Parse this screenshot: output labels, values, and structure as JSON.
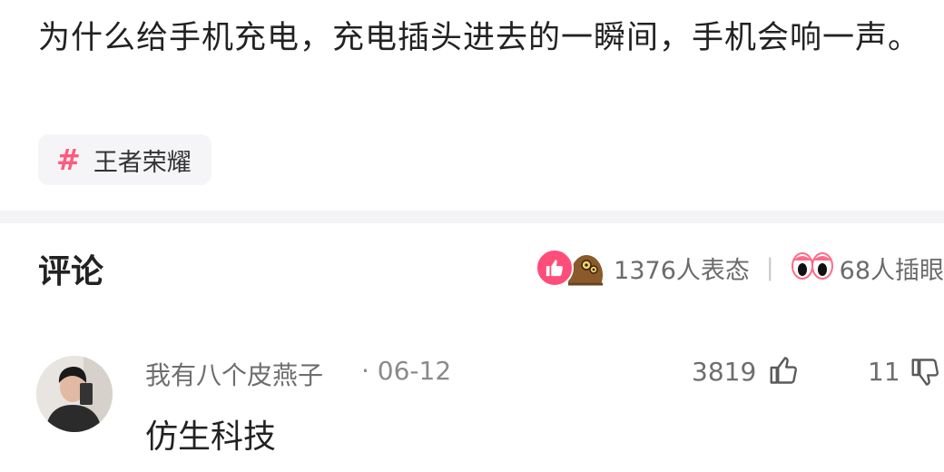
{
  "post": {
    "title": "为什么给手机充电，充电插头进去的一瞬间，手机会响一声。",
    "topic_hash": "#",
    "topic": "王者荣耀"
  },
  "comments_section": {
    "heading": "评论",
    "reactions": {
      "count_text": "1376人表态",
      "separator": "|",
      "watchers_text": "68人插眼"
    }
  },
  "comment": {
    "author": "我有八个皮燕子",
    "date": "· 06-12",
    "text": "仿生科技",
    "likes": "3819",
    "dislikes": "11"
  },
  "colors": {
    "accent": "#ff4d7a",
    "tag_bg": "#f5f5f7",
    "muted_text": "#6e6e6e"
  },
  "icons": [
    "hash-icon",
    "thumb-up-badge-icon",
    "blob-creature-icon",
    "eyes-icon",
    "avatar-image",
    "thumb-up-icon",
    "thumb-down-icon"
  ]
}
